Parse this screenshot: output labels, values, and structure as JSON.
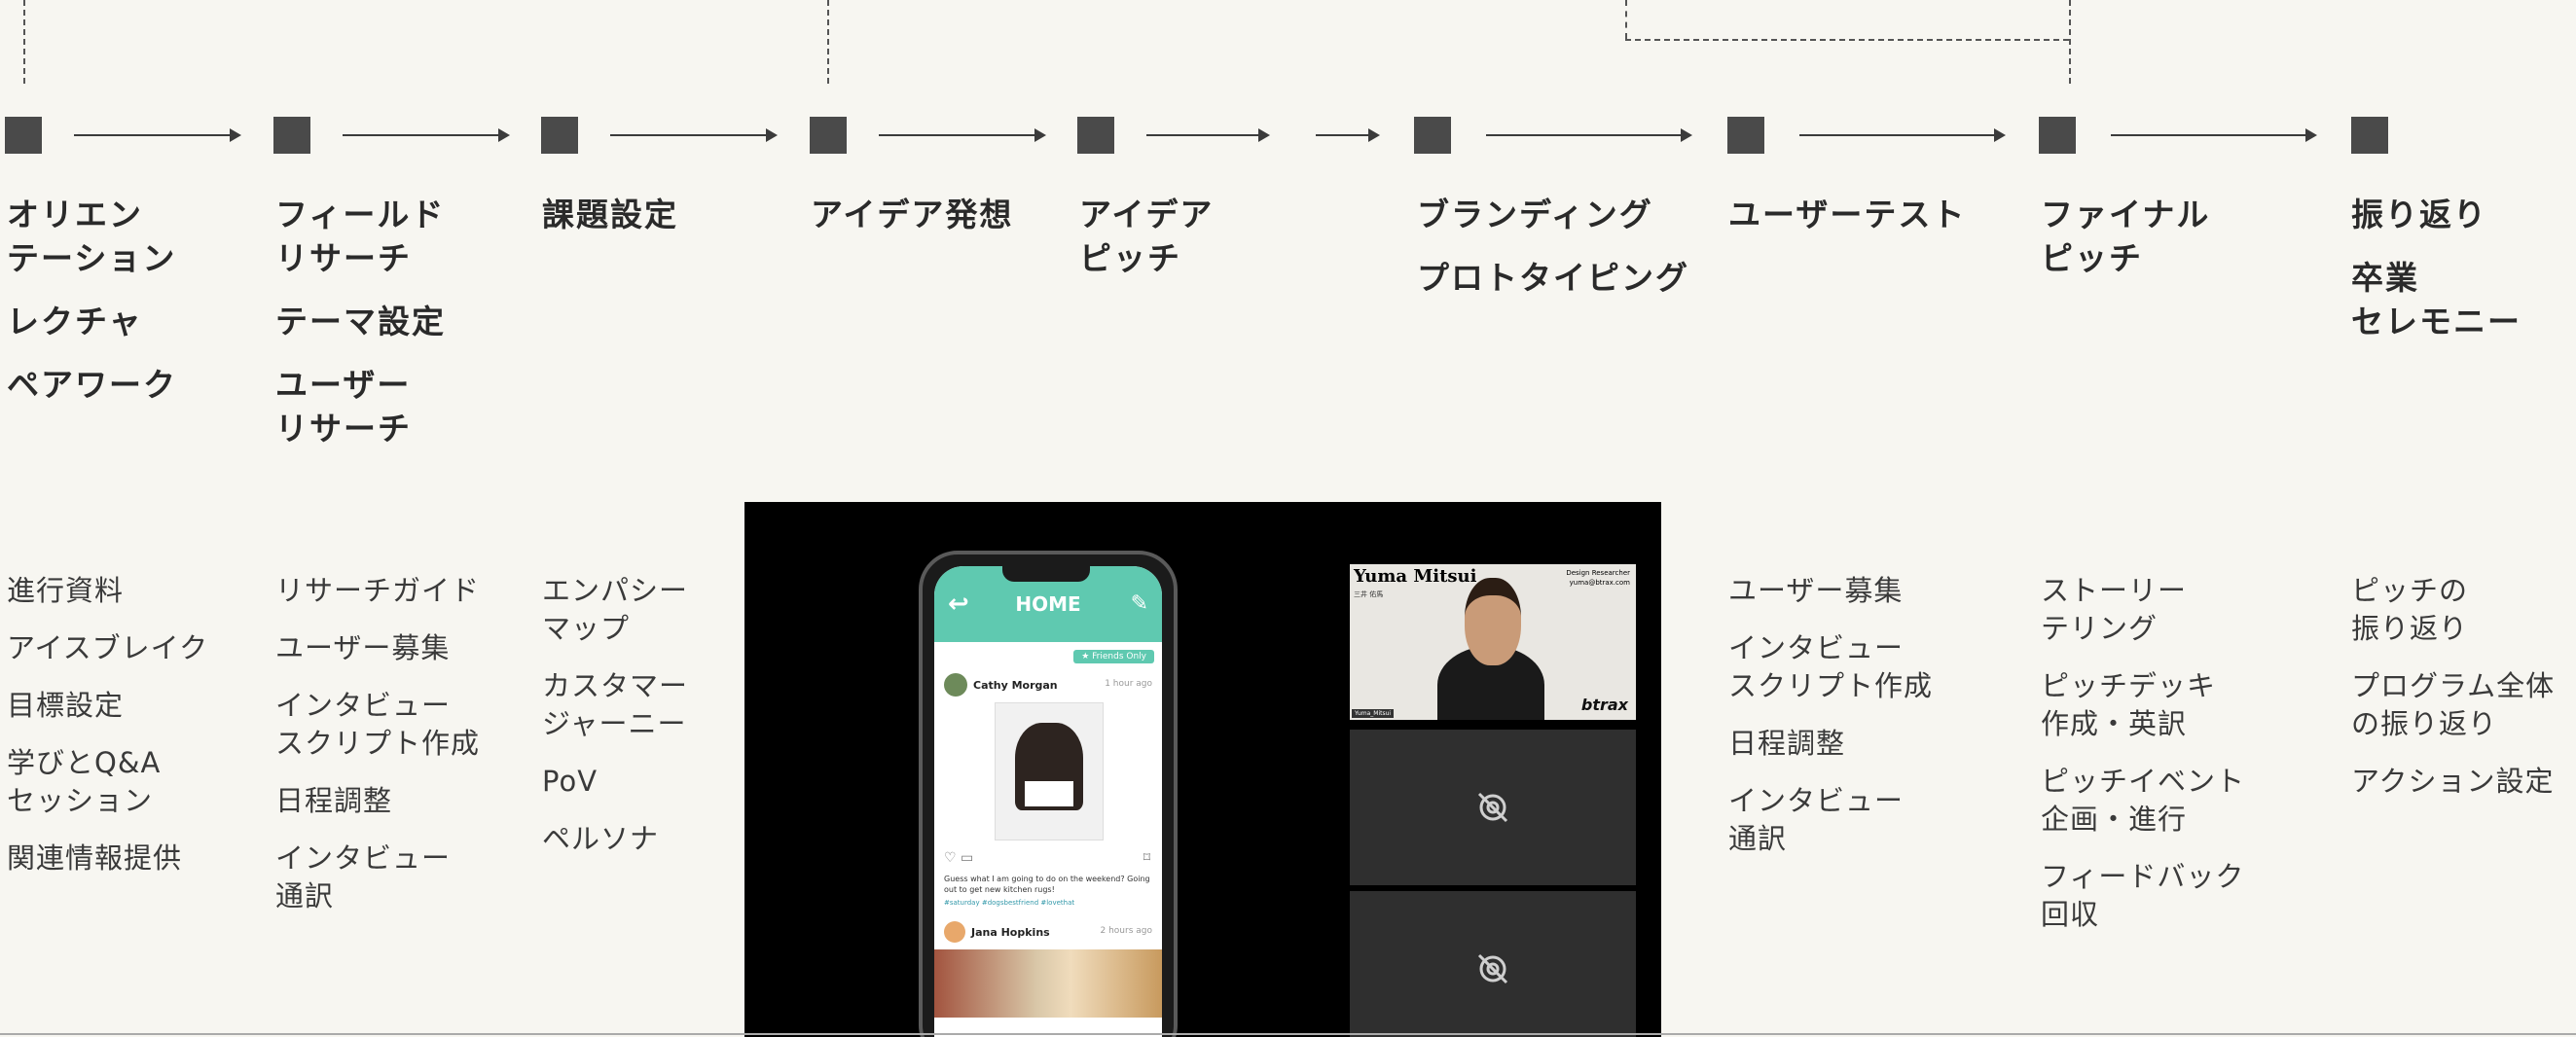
{
  "phases": [
    {
      "lines": [
        "オリエン\nテーション",
        "レクチャ",
        "ペアワーク"
      ]
    },
    {
      "lines": [
        "フィールド\nリサーチ",
        "テーマ設定",
        "ユーザー\nリサーチ"
      ]
    },
    {
      "lines": [
        "課題設定"
      ]
    },
    {
      "lines": [
        "アイデア発想"
      ]
    },
    {
      "lines": [
        "アイデア\nピッチ"
      ]
    },
    {
      "lines": [
        "ブランディング",
        "プロトタイピング"
      ]
    },
    {
      "lines": [
        "ユーザーテスト"
      ]
    },
    {
      "lines": [
        "ファイナル\nピッチ"
      ]
    },
    {
      "lines": [
        "振り返り",
        "卒業\nセレモニー"
      ]
    }
  ],
  "tasks": [
    {
      "items": [
        "進行資料",
        "アイスブレイク",
        "目標設定",
        "学びとQ&A\nセッション",
        "関連情報提供"
      ]
    },
    {
      "items": [
        "リサーチガイド",
        "ユーザー募集",
        "インタビュー\nスクリプト作成",
        "日程調整",
        "インタビュー\n通訳"
      ]
    },
    {
      "items": [
        "エンパシー\nマップ",
        "カスタマー\nジャーニー",
        "PoV",
        "ペルソナ"
      ]
    },
    {
      "items": [
        "ユーザー募集",
        "インタビュー\nスクリプト作成",
        "日程調整",
        "インタビュー\n通訳"
      ]
    },
    {
      "items": [
        "ストーリー\nテリング",
        "ピッチデッキ\n作成・英訳",
        "ピッチイベント\n企画・進行",
        "フィードバック\n回収"
      ]
    },
    {
      "items": [
        "ピッチの\n振り返り",
        "プログラム全体\nの振り返り",
        "アクション設定"
      ]
    }
  ],
  "phone": {
    "title": "HOME",
    "tag": "★ Friends Only",
    "post1_user": "Cathy Morgan",
    "post1_time": "1 hour ago",
    "caption": "Guess what I am going to do on the weekend? Going out to get new kitchen rugs!",
    "hashtags": "#saturday #dogsbestfriend #lovethat",
    "post2_user": "Jana Hopkins",
    "post2_time": "2 hours ago"
  },
  "speaker": {
    "name": "Yuma Mitsui",
    "sub": "三井 佑馬",
    "role": "Design Researcher",
    "email": "yuma@btrax.com",
    "brand": "btrax",
    "tag": "Yuma_Mitsui"
  },
  "icons": {
    "back": "back-arrow-icon",
    "edit": "edit-pencil-icon",
    "camera_off": "camera-off-icon"
  },
  "colors": {
    "node": "#4a4a4a",
    "app_accent": "#5fc9b0",
    "background": "#f7f6f1"
  }
}
